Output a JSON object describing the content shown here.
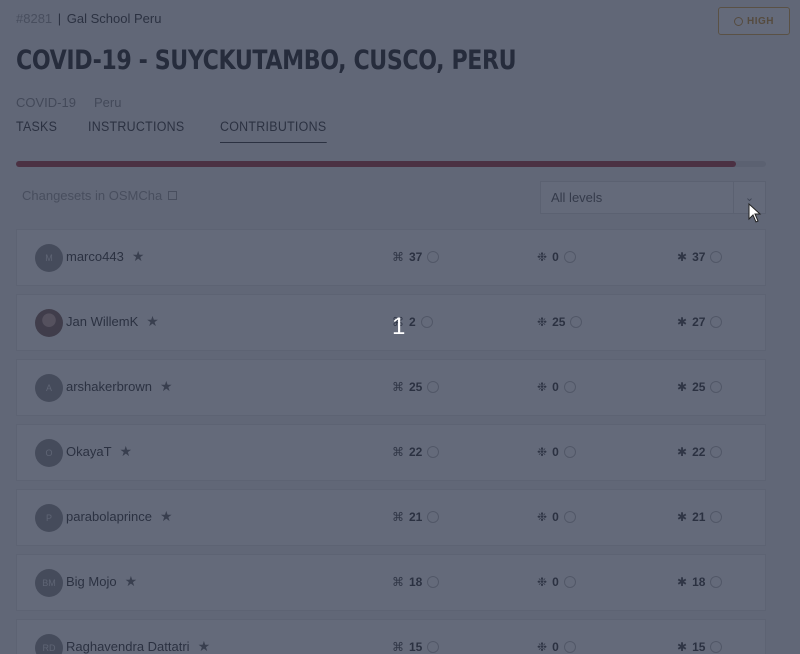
{
  "header": {
    "project_id": "#8281",
    "separator": "|",
    "organisation": "Gal School Peru",
    "priority_label": "HIGH",
    "title": "COVID-19 - SUYCKUTAMBO, CUSCO, PERU",
    "tags": [
      "COVID-19",
      "Peru"
    ]
  },
  "tabs": [
    {
      "label": "TASKS"
    },
    {
      "label": "INSTRUCTIONS"
    },
    {
      "label": "CONTRIBUTIONS",
      "active": true
    }
  ],
  "progress": {
    "percent": 96,
    "color": "#a7343a"
  },
  "toolbar": {
    "osmcha_link": "Changesets in OSMCha",
    "level_filter": "All levels"
  },
  "contributors": [
    {
      "initials": "M",
      "name": "marco443",
      "mapped": "37",
      "validated": "0",
      "total": "37"
    },
    {
      "initials": "",
      "name": "Jan WillemK",
      "mapped": "2",
      "validated": "25",
      "total": "27"
    },
    {
      "initials": "A",
      "name": "arshakerbrown",
      "mapped": "25",
      "validated": "0",
      "total": "25"
    },
    {
      "initials": "O",
      "name": "OkayaT",
      "mapped": "22",
      "validated": "0",
      "total": "22"
    },
    {
      "initials": "P",
      "name": "parabolaprince",
      "mapped": "21",
      "validated": "0",
      "total": "21"
    },
    {
      "initials": "BM",
      "name": "Big Mojo",
      "mapped": "18",
      "validated": "0",
      "total": "18"
    },
    {
      "initials": "RD",
      "name": "Raghavendra Dattatri",
      "mapped": "15",
      "validated": "0",
      "total": "15"
    }
  ],
  "overlay": {
    "step_number": "1"
  }
}
